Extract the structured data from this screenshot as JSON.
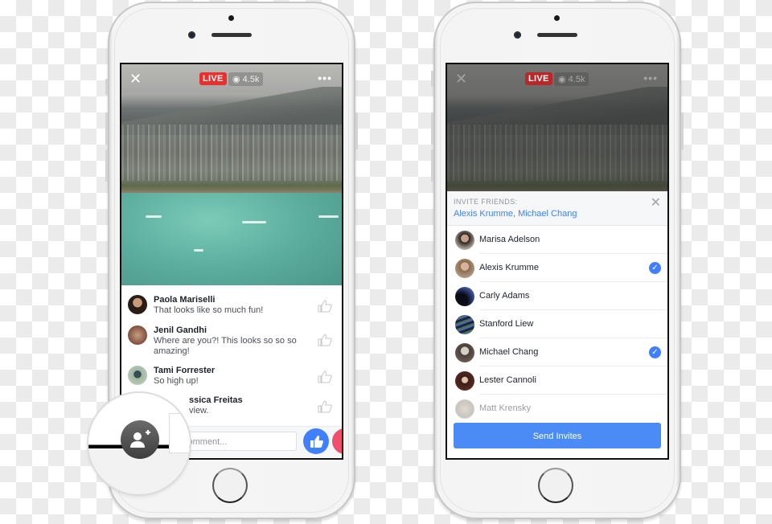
{
  "live_view": {
    "live_badge": "LIVE",
    "viewer_count": "4.5k",
    "close_icon": "close-icon",
    "more_icon": "more-dots-icon",
    "comments": [
      {
        "name": "Paola Mariselli",
        "text": "That looks like so much fun!"
      },
      {
        "name": "Jenil Gandhi",
        "text": "Where are you?! This looks so so so amazing!"
      },
      {
        "name": "Tami Forrester",
        "text": "So high up!"
      },
      {
        "name": "Jessica Freitas",
        "text": "...a view.",
        "visible_name": "ssica Freitas",
        "visible_text": "view."
      }
    ],
    "comment_placeholder": "Write a comment...",
    "comment_visible_placeholder": "comment...",
    "invite_icon": "add-friend-icon",
    "like_icon": "thumbs-up-icon",
    "love_icon": "heart-icon"
  },
  "invite_view": {
    "live_badge": "LIVE",
    "viewer_count": "4.5k",
    "header_label": "INVITE FRIENDS:",
    "selected_text": "Alexis Krumme, Michael Chang",
    "friends": [
      {
        "name": "Marisa Adelson",
        "selected": false
      },
      {
        "name": "Alexis Krumme",
        "selected": true
      },
      {
        "name": "Carly Adams",
        "selected": false
      },
      {
        "name": "Stanford Liew",
        "selected": false
      },
      {
        "name": "Michael Chang",
        "selected": true
      },
      {
        "name": "Lester Cannoli",
        "selected": false
      },
      {
        "name": "Matt Krensky",
        "selected": false
      }
    ],
    "send_label": "Send Invites",
    "check_glyph": "✓"
  },
  "colors": {
    "live_red": "#e8302f",
    "accent_blue": "#4080ff",
    "send_blue": "#4b8bf5"
  }
}
